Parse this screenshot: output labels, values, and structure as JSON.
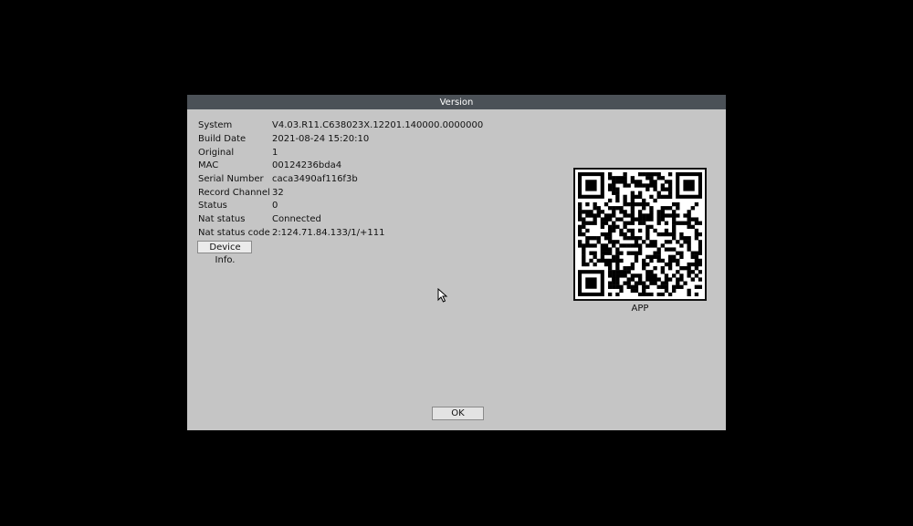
{
  "dialog": {
    "title": "Version",
    "rows": [
      {
        "label": "System",
        "value": "V4.03.R11.C638023X.12201.140000.0000000"
      },
      {
        "label": "Build Date",
        "value": "2021-08-24 15:20:10"
      },
      {
        "label": "Original",
        "value": "1"
      },
      {
        "label": "MAC",
        "value": "00124236bda4"
      },
      {
        "label": "Serial Number",
        "value": "caca3490af116f3b"
      },
      {
        "label": "Record Channel",
        "value": "32"
      },
      {
        "label": "Status",
        "value": "0"
      },
      {
        "label": "Nat status",
        "value": "Connected"
      },
      {
        "label": "Nat status code",
        "value": "2:124.71.84.133/1/+111"
      }
    ],
    "device_info_label": "Device Info.",
    "qr_caption": "APP",
    "ok_label": "OK"
  },
  "icons": {
    "qr_code": "qr-code-icon",
    "cursor": "mouse-pointer-icon"
  },
  "colors": {
    "background": "#000000",
    "dialog_body": "#c5c5c5",
    "title_bar": "#4b5157",
    "title_text": "#ffffff"
  }
}
